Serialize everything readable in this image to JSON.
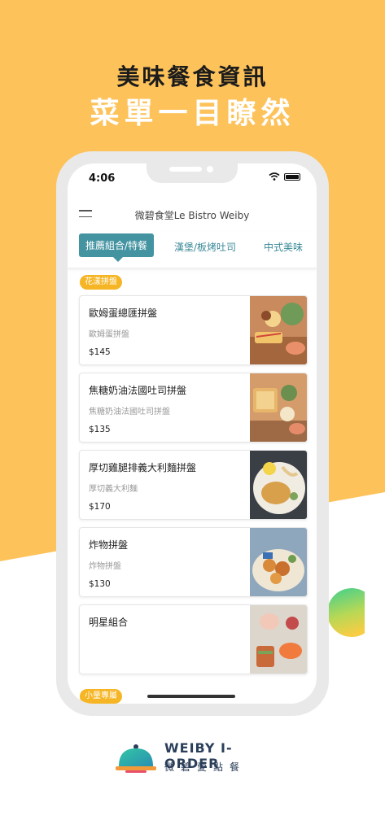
{
  "headline": {
    "line1": "美味餐食資訊",
    "line2": "菜單一目瞭然"
  },
  "status_bar": {
    "time": "4:06"
  },
  "app": {
    "title": "微碧食堂Le Bistro Weiby"
  },
  "tabs": [
    {
      "label": "推薦組合/特餐",
      "active": true
    },
    {
      "label": "漢堡/板烤吐司",
      "active": false
    },
    {
      "label": "中式美味",
      "active": false
    }
  ],
  "sections": [
    {
      "label": "花漾拼盤"
    },
    {
      "label": "小量專屬"
    }
  ],
  "menu_items": [
    {
      "name": "歐姆蛋總匯拼盤",
      "desc": "歐姆蛋拼盤",
      "price": "$145"
    },
    {
      "name": "焦糖奶油法國吐司拼盤",
      "desc": "焦糖奶油法國吐司拼盤",
      "price": "$135"
    },
    {
      "name": "厚切雞腿排義大利麵拼盤",
      "desc": "厚切義大利麵",
      "price": "$170"
    },
    {
      "name": "炸物拼盤",
      "desc": "炸物拼盤",
      "price": "$130"
    },
    {
      "name": "明星組合",
      "desc": "",
      "price": ""
    }
  ],
  "brand": {
    "name_en": "WEIBY I-ORDER",
    "name_zh": "微碧愛點餐"
  },
  "colors": {
    "background_yellow": "#fdc25a",
    "accent_teal": "#4393a1",
    "badge_yellow": "#f6b524"
  }
}
